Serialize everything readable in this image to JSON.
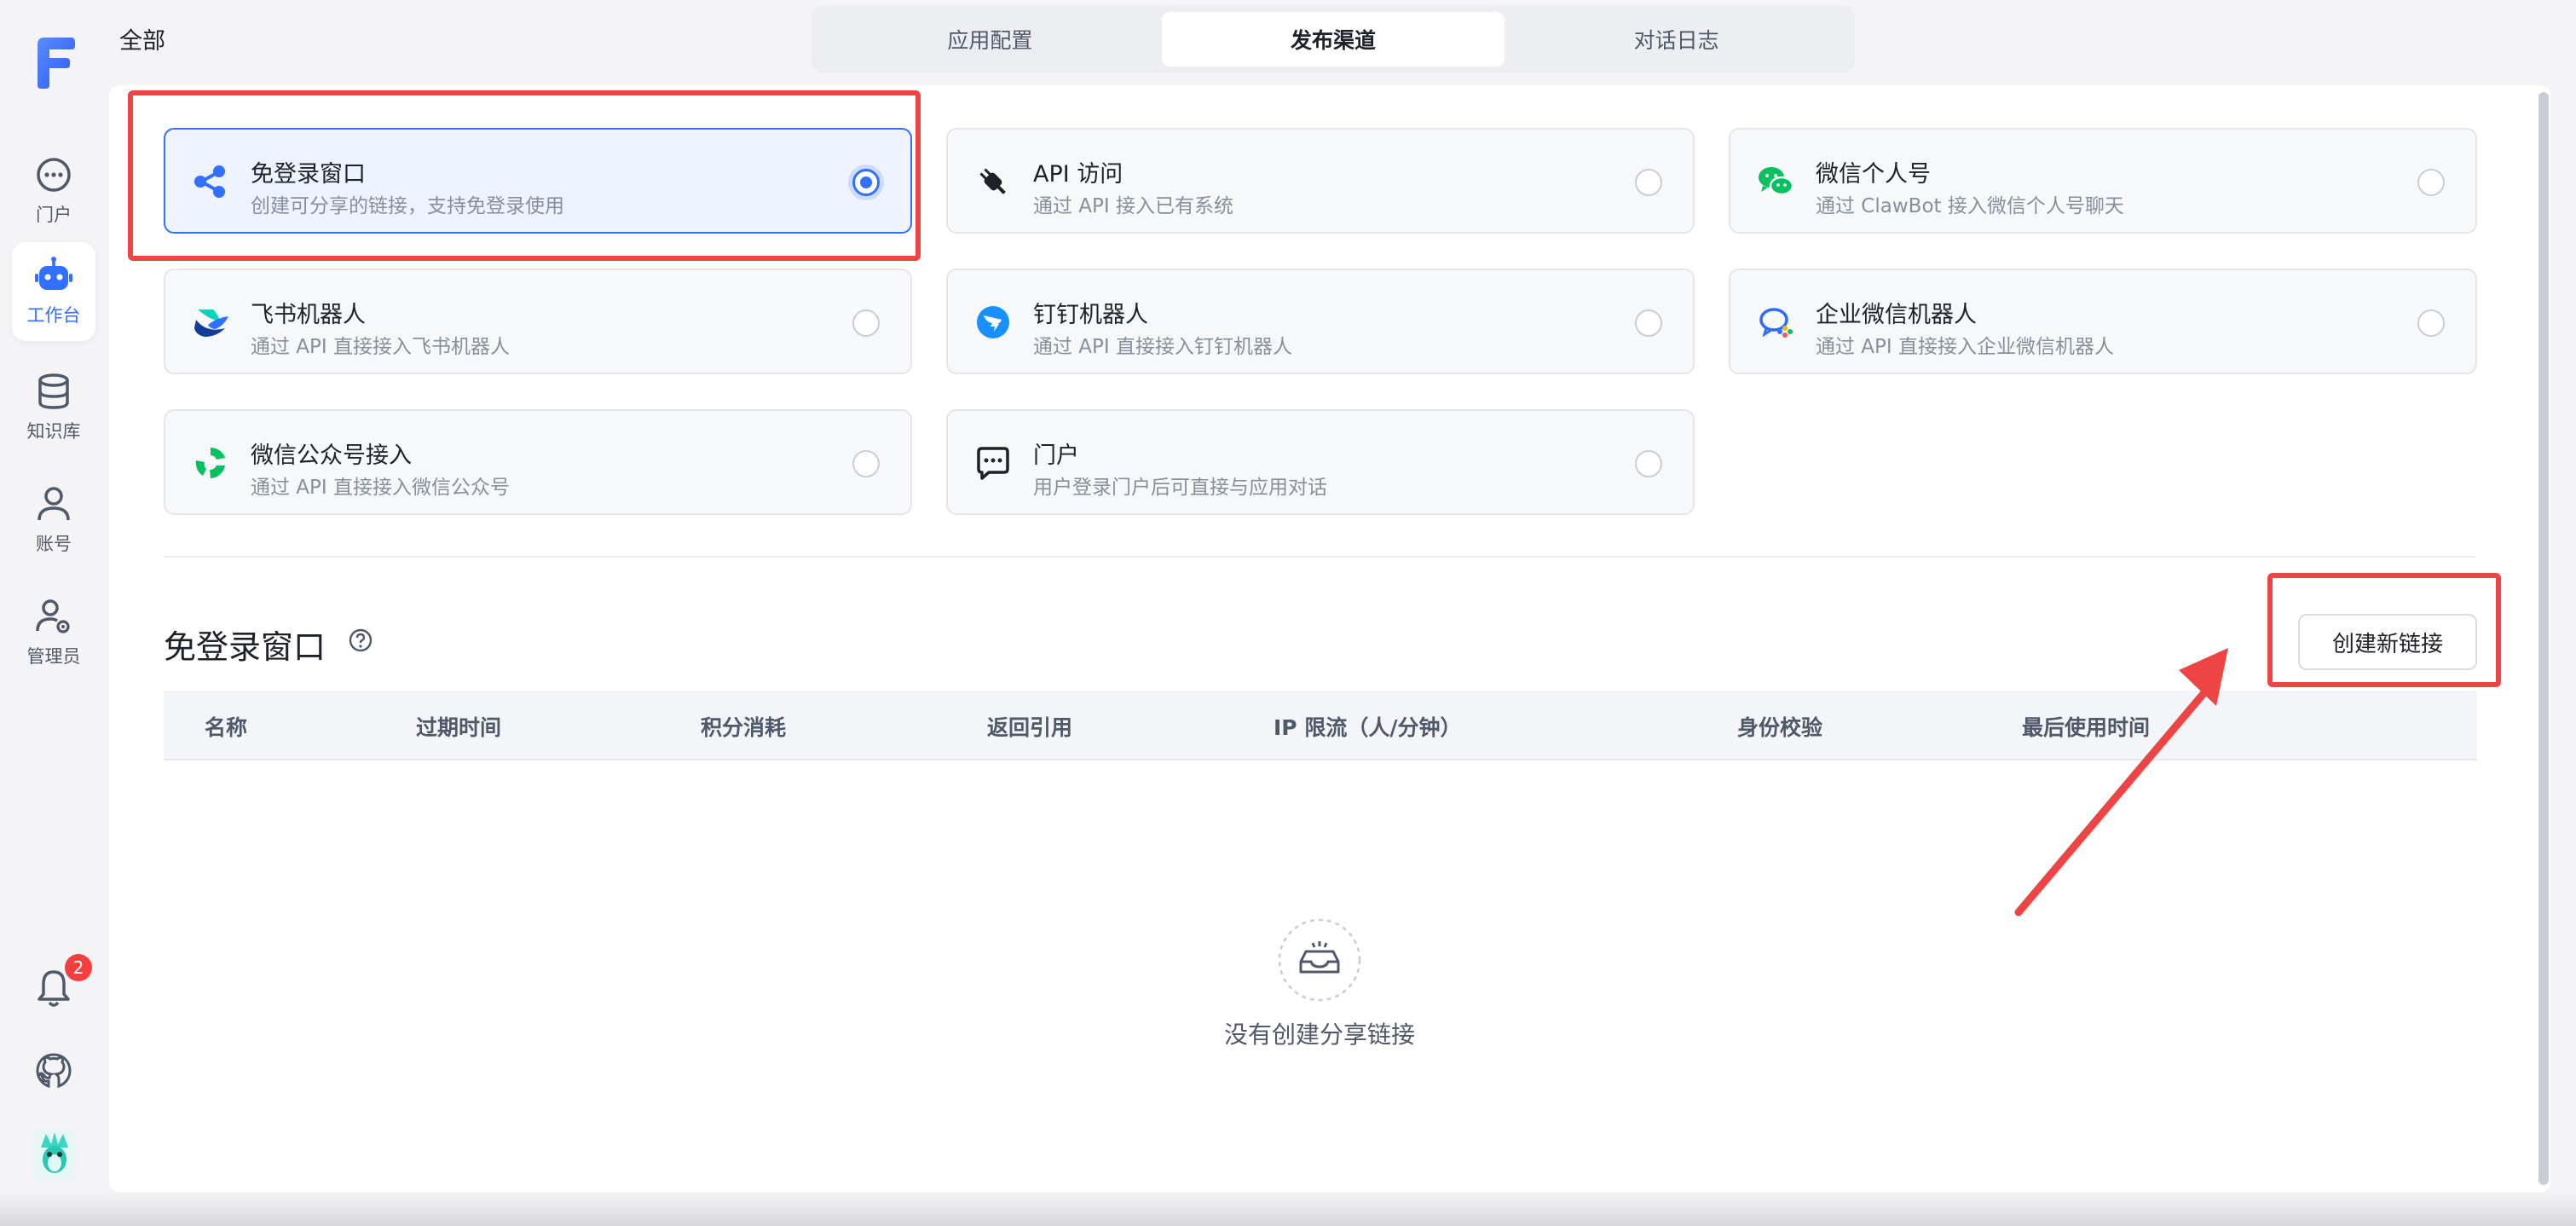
{
  "sidebar": {
    "items": [
      {
        "label": "门户",
        "icon": "chat-icon"
      },
      {
        "label": "工作台",
        "icon": "robot-icon",
        "active": true
      },
      {
        "label": "知识库",
        "icon": "database-icon"
      },
      {
        "label": "账号",
        "icon": "user-icon"
      },
      {
        "label": "管理员",
        "icon": "user-gear-icon"
      }
    ],
    "notification_count": "2"
  },
  "header": {
    "breadcrumb": "全部",
    "tabs": [
      {
        "label": "应用配置"
      },
      {
        "label": "发布渠道",
        "active": true
      },
      {
        "label": "对话日志"
      }
    ]
  },
  "channels": [
    {
      "title": "免登录窗口",
      "desc": "创建可分享的链接，支持免登录使用",
      "icon": "share-icon",
      "selected": true
    },
    {
      "title": "API 访问",
      "desc": "通过 API 接入已有系统",
      "icon": "plug-icon",
      "selected": false
    },
    {
      "title": "微信个人号",
      "desc": "通过 ClawBot 接入微信个人号聊天",
      "icon": "wechat-icon",
      "selected": false
    },
    {
      "title": "飞书机器人",
      "desc": "通过 API 直接接入飞书机器人",
      "icon": "feishu-icon",
      "selected": false
    },
    {
      "title": "钉钉机器人",
      "desc": "通过 API 直接接入钉钉机器人",
      "icon": "dingtalk-icon",
      "selected": false
    },
    {
      "title": "企业微信机器人",
      "desc": "通过 API 直接接入企业微信机器人",
      "icon": "wecom-icon",
      "selected": false
    },
    {
      "title": "微信公众号接入",
      "desc": "通过 API 直接接入微信公众号",
      "icon": "wechat-official-icon",
      "selected": false
    },
    {
      "title": "门户",
      "desc": "用户登录门户后可直接与应用对话",
      "icon": "portal-chat-icon",
      "selected": false
    }
  ],
  "section": {
    "title": "免登录窗口",
    "create_button": "创建新链接",
    "columns": [
      "名称",
      "过期时间",
      "积分消耗",
      "返回引用",
      "IP 限流（人/分钟）",
      "身份校验",
      "最后使用时间"
    ],
    "empty_text": "没有创建分享链接"
  },
  "colors": {
    "accent": "#3370ff",
    "annotation": "#ef4444",
    "wechat_green": "#07c160",
    "dingtalk_blue": "#1890ff"
  }
}
